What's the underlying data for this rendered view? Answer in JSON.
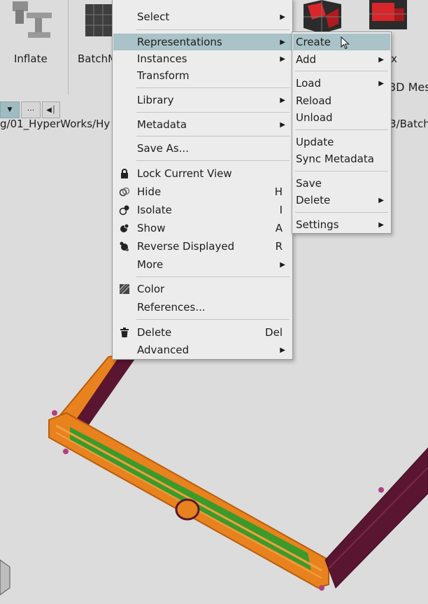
{
  "toolbar": {
    "inflate_label": "Inflate",
    "batchmesh_label": "BatchM",
    "right_label_1": "ex",
    "right_label_2": "3D Mes",
    "path_left": "g/01_HyperWorks/Hy",
    "path_right": "3/Batch",
    "more_btn": "···"
  },
  "context_menu": {
    "items": [
      {
        "label": "Select",
        "submenu": true
      },
      {
        "label": "Representations",
        "submenu": true,
        "highlighted": true
      },
      {
        "label": "Instances",
        "submenu": true
      },
      {
        "label": "Transform"
      },
      {
        "label": "Library",
        "submenu": true
      },
      {
        "label": "Metadata",
        "submenu": true
      },
      {
        "label": "Save As..."
      },
      {
        "label": "Lock Current View",
        "icon": "lock-icon"
      },
      {
        "label": "Hide",
        "icon": "hide-icon",
        "shortcut": "H"
      },
      {
        "label": "Isolate",
        "icon": "isolate-icon",
        "shortcut": "I"
      },
      {
        "label": "Show",
        "icon": "show-icon",
        "shortcut": "A"
      },
      {
        "label": "Reverse Displayed",
        "icon": "reverse-displayed-icon",
        "shortcut": "R"
      },
      {
        "label": "More",
        "submenu": true
      },
      {
        "label": "Color",
        "icon": "color-icon"
      },
      {
        "label": "References..."
      },
      {
        "label": "Delete",
        "icon": "trash-icon",
        "shortcut": "Del"
      },
      {
        "label": "Advanced",
        "submenu": true
      }
    ]
  },
  "submenu": {
    "items": [
      {
        "label": "Create",
        "highlighted": true
      },
      {
        "label": "Add",
        "submenu": true
      },
      {
        "label": "Load",
        "submenu": true
      },
      {
        "label": "Reload"
      },
      {
        "label": "Unload"
      },
      {
        "label": "Update"
      },
      {
        "label": "Sync Metadata"
      },
      {
        "label": "Save"
      },
      {
        "label": "Delete",
        "submenu": true
      },
      {
        "label": "Settings",
        "submenu": true
      }
    ]
  },
  "colors": {
    "menu_bg": "#ececec",
    "highlight": "#a9c3c8",
    "model_orange": "#e8821e",
    "model_green": "#3c9a2a",
    "model_maroon": "#5a1630"
  }
}
